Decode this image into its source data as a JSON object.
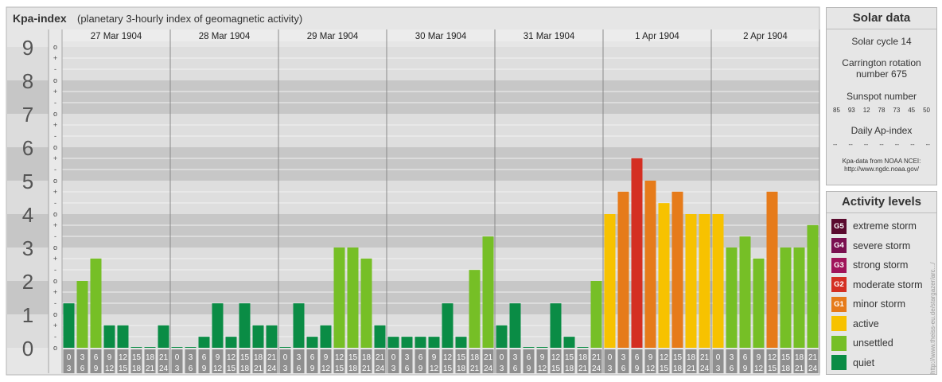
{
  "header": {
    "title": "Kpa-index",
    "subtitle": "(planetary 3-hourly index of geomagnetic activity)"
  },
  "solar": {
    "title": "Solar data",
    "cycle": "Solar cycle 14",
    "carrington_line1": "Carrington rotation",
    "carrington_line2": "number 675",
    "sunspot_label": "Sunspot number",
    "sunspots": [
      "85",
      "93",
      "12",
      "78",
      "73",
      "45",
      "50"
    ],
    "ap_label": "Daily Ap-index",
    "ap_values": [
      "--",
      "--",
      "--",
      "--",
      "--",
      "--",
      "--"
    ],
    "source_line1": "Kpa-data from NOAA NCEI:",
    "source_line2": "http://www.ngdc.noaa.gov/"
  },
  "activity": {
    "title": "Activity levels",
    "levels": [
      {
        "badge": "G5",
        "label": "extreme storm",
        "color": "#5a0a2e"
      },
      {
        "badge": "G4",
        "label": "severe storm",
        "color": "#7a1050"
      },
      {
        "badge": "G3",
        "label": "strong storm",
        "color": "#a0145a"
      },
      {
        "badge": "G2",
        "label": "moderate storm",
        "color": "#d42f22"
      },
      {
        "badge": "G1",
        "label": "minor storm",
        "color": "#e67b1a"
      },
      {
        "badge": "",
        "label": "active",
        "color": "#f7c200"
      },
      {
        "badge": "",
        "label": "unsettled",
        "color": "#76bf26"
      },
      {
        "badge": "",
        "label": "quiet",
        "color": "#0a8c45"
      }
    ]
  },
  "credit": "http://www.theiss-eu.de/stargazer/arc.../",
  "chart_data": {
    "type": "bar",
    "title": "Kpa-index",
    "subtitle": "(planetary 3-hourly index of geomagnetic activity)",
    "ylim": [
      0,
      9
    ],
    "yticks": [
      "0",
      "1",
      "2",
      "3",
      "4",
      "5",
      "6",
      "7",
      "8",
      "9"
    ],
    "subticks": [
      "o",
      "-",
      "+"
    ],
    "days": [
      "27 Mar 1904",
      "28 Mar 1904",
      "29 Mar 1904",
      "30 Mar 1904",
      "31 Mar 1904",
      "1 Apr 1904",
      "2 Apr 1904"
    ],
    "interval_start": [
      "0",
      "3",
      "6",
      "9",
      "12",
      "15",
      "18",
      "21"
    ],
    "interval_end": [
      "3",
      "6",
      "9",
      "12",
      "15",
      "18",
      "21",
      "24"
    ],
    "values": [
      [
        1.33,
        2.0,
        2.67,
        0.67,
        0.67,
        0.0,
        0.0,
        0.67
      ],
      [
        0.0,
        0.0,
        0.33,
        1.33,
        0.33,
        1.33,
        0.67,
        0.67
      ],
      [
        0.0,
        1.33,
        0.33,
        0.67,
        3.0,
        3.0,
        2.67,
        0.67
      ],
      [
        0.33,
        0.33,
        0.33,
        0.33,
        1.33,
        0.33,
        2.33,
        3.33
      ],
      [
        0.67,
        1.33,
        0.0,
        0.0,
        1.33,
        0.33,
        0.0,
        2.0
      ],
      [
        4.0,
        4.67,
        5.67,
        5.0,
        4.33,
        4.67,
        4.0,
        4.0
      ],
      [
        4.0,
        3.0,
        3.33,
        2.67,
        4.67,
        3.0,
        3.0,
        3.67
      ]
    ],
    "colors": {
      "quiet": "#0a8c45",
      "unsettled": "#76bf26",
      "active": "#f7c200",
      "minor_storm": "#e67b1a",
      "moderate_storm": "#d42f22"
    }
  }
}
